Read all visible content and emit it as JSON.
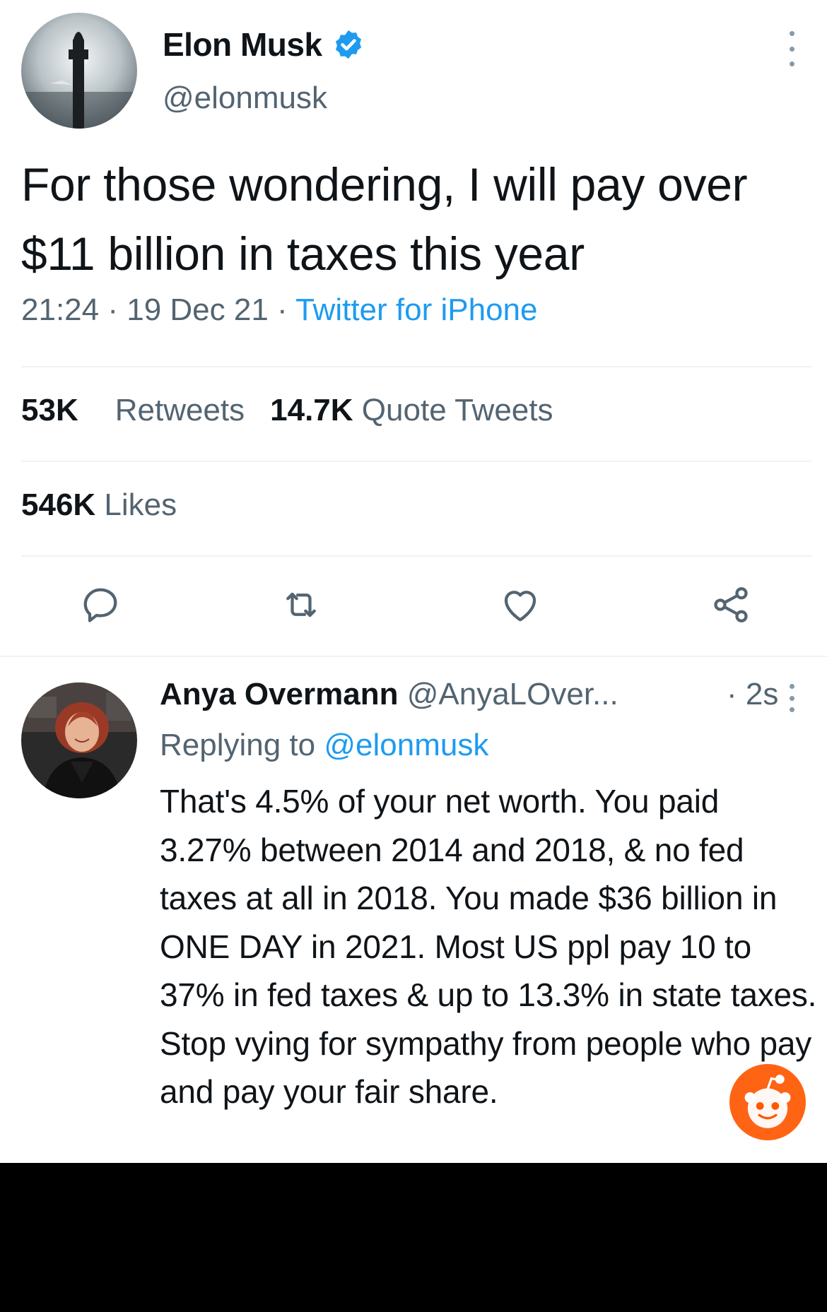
{
  "main_tweet": {
    "author_name": "Elon Musk",
    "author_handle": "@elonmusk",
    "verified_icon": "verified-badge-icon",
    "text": "For those wondering, I will pay over $11 billion in taxes this year",
    "time": "21:24",
    "date": "19 Dec 21",
    "separator": " · ",
    "source": "Twitter for iPhone",
    "stats": {
      "retweets_count": "53K",
      "retweets_label": "Retweets",
      "quotes_count": "14.7K",
      "quotes_label": "Quote Tweets",
      "likes_count": "546K",
      "likes_label": "Likes"
    },
    "actions": [
      "reply-icon",
      "retweet-icon",
      "like-icon",
      "share-icon"
    ]
  },
  "reply_tweet": {
    "author_name": "Anya Overmann",
    "author_handle": "@AnyaLOver...",
    "time": "· 2s",
    "replying_label": "Replying to",
    "replying_to": "@elonmusk",
    "text": "That's 4.5% of your net worth. You paid 3.27% between 2014 and 2018, & no fed taxes at all in 2018. You made $36 billion in ONE DAY in 2021. Most US ppl pay 10 to 37% in fed taxes & up to 13.3% in state taxes. Stop vying for sympathy from people who pay and pay your fair share."
  },
  "watermark_icon": "reddit-logo-icon",
  "colors": {
    "accent": "#1d9bf0",
    "secondary_text": "#536471",
    "primary_text": "#0f1419",
    "reddit_orange": "#ff5700"
  }
}
